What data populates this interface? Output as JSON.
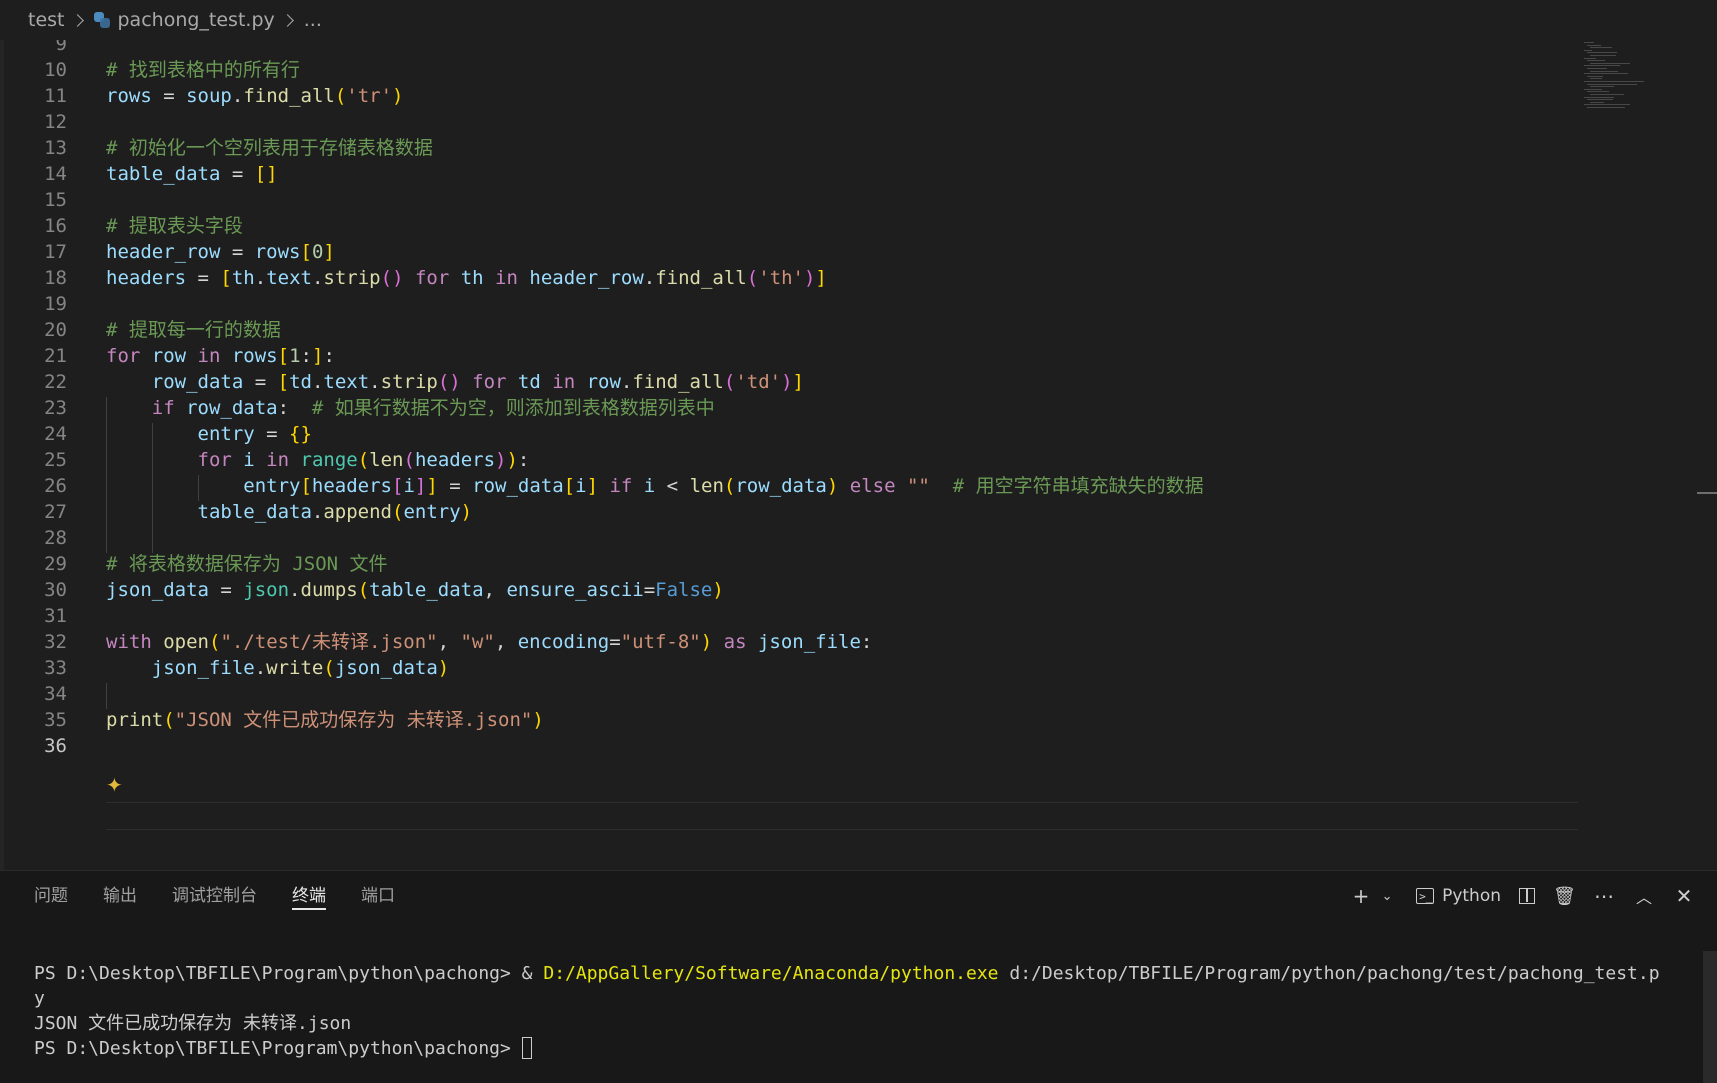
{
  "breadcrumb": {
    "folder": "test",
    "file": "pachong_test.py",
    "more": "..."
  },
  "editor": {
    "active_line": "36",
    "lines": [
      {
        "n": "9",
        "tokens": []
      },
      {
        "n": "10",
        "tokens": [
          {
            "t": "# 找到表格中的所有行",
            "c": "t-com"
          }
        ]
      },
      {
        "n": "11",
        "tokens": [
          {
            "t": "rows",
            "c": "t-var"
          },
          {
            "t": " = ",
            "c": "t-op"
          },
          {
            "t": "soup",
            "c": "t-var"
          },
          {
            "t": ".",
            "c": "t-op"
          },
          {
            "t": "find_all",
            "c": "t-fn"
          },
          {
            "t": "(",
            "c": "b1"
          },
          {
            "t": "'tr'",
            "c": "t-str"
          },
          {
            "t": ")",
            "c": "b1"
          }
        ]
      },
      {
        "n": "12",
        "tokens": []
      },
      {
        "n": "13",
        "tokens": [
          {
            "t": "# 初始化一个空列表用于存储表格数据",
            "c": "t-com"
          }
        ]
      },
      {
        "n": "14",
        "tokens": [
          {
            "t": "table_data",
            "c": "t-var"
          },
          {
            "t": " = ",
            "c": "t-op"
          },
          {
            "t": "[]",
            "c": "b1"
          }
        ]
      },
      {
        "n": "15",
        "tokens": []
      },
      {
        "n": "16",
        "tokens": [
          {
            "t": "# 提取表头字段",
            "c": "t-com"
          }
        ]
      },
      {
        "n": "17",
        "tokens": [
          {
            "t": "header_row",
            "c": "t-var"
          },
          {
            "t": " = ",
            "c": "t-op"
          },
          {
            "t": "rows",
            "c": "t-var"
          },
          {
            "t": "[",
            "c": "b1"
          },
          {
            "t": "0",
            "c": "t-num"
          },
          {
            "t": "]",
            "c": "b1"
          }
        ]
      },
      {
        "n": "18",
        "tokens": [
          {
            "t": "headers",
            "c": "t-var"
          },
          {
            "t": " = ",
            "c": "t-op"
          },
          {
            "t": "[",
            "c": "b1"
          },
          {
            "t": "th",
            "c": "t-var"
          },
          {
            "t": ".",
            "c": "t-op"
          },
          {
            "t": "text",
            "c": "t-var"
          },
          {
            "t": ".",
            "c": "t-op"
          },
          {
            "t": "strip",
            "c": "t-fn"
          },
          {
            "t": "()",
            "c": "b2"
          },
          {
            "t": " for ",
            "c": "t-kw"
          },
          {
            "t": "th",
            "c": "t-var"
          },
          {
            "t": " in ",
            "c": "t-kw"
          },
          {
            "t": "header_row",
            "c": "t-var"
          },
          {
            "t": ".",
            "c": "t-op"
          },
          {
            "t": "find_all",
            "c": "t-fn"
          },
          {
            "t": "(",
            "c": "b2"
          },
          {
            "t": "'th'",
            "c": "t-str"
          },
          {
            "t": ")",
            "c": "b2"
          },
          {
            "t": "]",
            "c": "b1"
          }
        ]
      },
      {
        "n": "19",
        "tokens": []
      },
      {
        "n": "20",
        "tokens": [
          {
            "t": "# 提取每一行的数据",
            "c": "t-com"
          }
        ]
      },
      {
        "n": "21",
        "tokens": [
          {
            "t": "for",
            "c": "t-kw"
          },
          {
            "t": " row",
            "c": "t-var"
          },
          {
            "t": " in ",
            "c": "t-kw"
          },
          {
            "t": "rows",
            "c": "t-var"
          },
          {
            "t": "[",
            "c": "b1"
          },
          {
            "t": "1",
            "c": "t-num"
          },
          {
            "t": ":",
            "c": "t-op"
          },
          {
            "t": "]",
            "c": "b1"
          },
          {
            "t": ":",
            "c": "t-op"
          }
        ]
      },
      {
        "n": "22",
        "tokens": [
          {
            "t": "    row_data",
            "c": "t-var"
          },
          {
            "t": " = ",
            "c": "t-op"
          },
          {
            "t": "[",
            "c": "b1"
          },
          {
            "t": "td",
            "c": "t-var"
          },
          {
            "t": ".",
            "c": "t-op"
          },
          {
            "t": "text",
            "c": "t-var"
          },
          {
            "t": ".",
            "c": "t-op"
          },
          {
            "t": "strip",
            "c": "t-fn"
          },
          {
            "t": "()",
            "c": "b2"
          },
          {
            "t": " for ",
            "c": "t-kw"
          },
          {
            "t": "td",
            "c": "t-var"
          },
          {
            "t": " in ",
            "c": "t-kw"
          },
          {
            "t": "row",
            "c": "t-var"
          },
          {
            "t": ".",
            "c": "t-op"
          },
          {
            "t": "find_all",
            "c": "t-fn"
          },
          {
            "t": "(",
            "c": "b2"
          },
          {
            "t": "'td'",
            "c": "t-str"
          },
          {
            "t": ")",
            "c": "b2"
          },
          {
            "t": "]",
            "c": "b1"
          }
        ]
      },
      {
        "n": "23",
        "tokens": [
          {
            "t": "    if",
            "c": "t-kw"
          },
          {
            "t": " row_data",
            "c": "t-var"
          },
          {
            "t": ":  ",
            "c": "t-op"
          },
          {
            "t": "# 如果行数据不为空，则添加到表格数据列表中",
            "c": "t-com"
          }
        ]
      },
      {
        "n": "24",
        "tokens": [
          {
            "t": "        entry",
            "c": "t-var"
          },
          {
            "t": " = ",
            "c": "t-op"
          },
          {
            "t": "{}",
            "c": "b1"
          }
        ]
      },
      {
        "n": "25",
        "tokens": [
          {
            "t": "        for",
            "c": "t-kw"
          },
          {
            "t": " i",
            "c": "t-var"
          },
          {
            "t": " in ",
            "c": "t-kw"
          },
          {
            "t": "range",
            "c": "t-cls"
          },
          {
            "t": "(",
            "c": "b1"
          },
          {
            "t": "len",
            "c": "t-fn"
          },
          {
            "t": "(",
            "c": "b2"
          },
          {
            "t": "headers",
            "c": "t-var"
          },
          {
            "t": ")",
            "c": "b2"
          },
          {
            "t": ")",
            "c": "b1"
          },
          {
            "t": ":",
            "c": "t-op"
          }
        ]
      },
      {
        "n": "26",
        "tokens": [
          {
            "t": "            entry",
            "c": "t-var"
          },
          {
            "t": "[",
            "c": "b1"
          },
          {
            "t": "headers",
            "c": "t-var"
          },
          {
            "t": "[",
            "c": "b2"
          },
          {
            "t": "i",
            "c": "t-var"
          },
          {
            "t": "]",
            "c": "b2"
          },
          {
            "t": "]",
            "c": "b1"
          },
          {
            "t": " = ",
            "c": "t-op"
          },
          {
            "t": "row_data",
            "c": "t-var"
          },
          {
            "t": "[",
            "c": "b1"
          },
          {
            "t": "i",
            "c": "t-var"
          },
          {
            "t": "]",
            "c": "b1"
          },
          {
            "t": " if",
            "c": "t-kw"
          },
          {
            "t": " i",
            "c": "t-var"
          },
          {
            "t": " < ",
            "c": "t-op"
          },
          {
            "t": "len",
            "c": "t-fn"
          },
          {
            "t": "(",
            "c": "b1"
          },
          {
            "t": "row_data",
            "c": "t-var"
          },
          {
            "t": ")",
            "c": "b1"
          },
          {
            "t": " else ",
            "c": "t-kw"
          },
          {
            "t": "\"\"",
            "c": "t-str"
          },
          {
            "t": "  ",
            "c": "t-op"
          },
          {
            "t": "# 用空字符串填充缺失的数据",
            "c": "t-com"
          }
        ]
      },
      {
        "n": "27",
        "tokens": [
          {
            "t": "        table_data",
            "c": "t-var"
          },
          {
            "t": ".",
            "c": "t-op"
          },
          {
            "t": "append",
            "c": "t-fn"
          },
          {
            "t": "(",
            "c": "b1"
          },
          {
            "t": "entry",
            "c": "t-var"
          },
          {
            "t": ")",
            "c": "b1"
          }
        ]
      },
      {
        "n": "28",
        "tokens": []
      },
      {
        "n": "29",
        "tokens": [
          {
            "t": "# 将表格数据保存为 JSON 文件",
            "c": "t-com"
          }
        ]
      },
      {
        "n": "30",
        "tokens": [
          {
            "t": "json_data",
            "c": "t-var"
          },
          {
            "t": " = ",
            "c": "t-op"
          },
          {
            "t": "json",
            "c": "t-cls"
          },
          {
            "t": ".",
            "c": "t-op"
          },
          {
            "t": "dumps",
            "c": "t-fn"
          },
          {
            "t": "(",
            "c": "b1"
          },
          {
            "t": "table_data",
            "c": "t-var"
          },
          {
            "t": ", ",
            "c": "t-op"
          },
          {
            "t": "ensure_ascii",
            "c": "t-var"
          },
          {
            "t": "=",
            "c": "t-op"
          },
          {
            "t": "False",
            "c": "t-kw2"
          },
          {
            "t": ")",
            "c": "b1"
          }
        ]
      },
      {
        "n": "31",
        "tokens": []
      },
      {
        "n": "32",
        "tokens": [
          {
            "t": "with",
            "c": "t-kw"
          },
          {
            "t": " ",
            "c": "t-op"
          },
          {
            "t": "open",
            "c": "t-fn"
          },
          {
            "t": "(",
            "c": "b1"
          },
          {
            "t": "\"./test/未转译.json\"",
            "c": "t-str"
          },
          {
            "t": ", ",
            "c": "t-op"
          },
          {
            "t": "\"w\"",
            "c": "t-str"
          },
          {
            "t": ", ",
            "c": "t-op"
          },
          {
            "t": "encoding",
            "c": "t-var"
          },
          {
            "t": "=",
            "c": "t-op"
          },
          {
            "t": "\"utf-8\"",
            "c": "t-str"
          },
          {
            "t": ")",
            "c": "b1"
          },
          {
            "t": " as ",
            "c": "t-kw"
          },
          {
            "t": "json_file",
            "c": "t-var"
          },
          {
            "t": ":",
            "c": "t-op"
          }
        ]
      },
      {
        "n": "33",
        "tokens": [
          {
            "t": "    json_file",
            "c": "t-var"
          },
          {
            "t": ".",
            "c": "t-op"
          },
          {
            "t": "write",
            "c": "t-fn"
          },
          {
            "t": "(",
            "c": "b1"
          },
          {
            "t": "json_data",
            "c": "t-var"
          },
          {
            "t": ")",
            "c": "b1"
          }
        ]
      },
      {
        "n": "34",
        "tokens": []
      },
      {
        "n": "35",
        "tokens": [
          {
            "t": "print",
            "c": "t-fn"
          },
          {
            "t": "(",
            "c": "b1"
          },
          {
            "t": "\"JSON 文件已成功保存为 未转译.json\"",
            "c": "t-str"
          },
          {
            "t": ")",
            "c": "b1"
          }
        ]
      },
      {
        "n": "36",
        "tokens": []
      }
    ]
  },
  "panel": {
    "tabs": [
      {
        "label": "问题",
        "active": false
      },
      {
        "label": "输出",
        "active": false
      },
      {
        "label": "调试控制台",
        "active": false
      },
      {
        "label": "终端",
        "active": true
      },
      {
        "label": "端口",
        "active": false
      }
    ],
    "actions": {
      "add_icon": "plus-icon",
      "dropdown_icon": "chevron-down-icon",
      "terminal_profile": "Python",
      "split_icon": "split-editor-icon",
      "trash_icon": "trash-icon",
      "more_icon": "ellipsis-icon",
      "maximize_icon": "chevron-up-icon",
      "close_icon": "close-icon"
    },
    "terminal": {
      "prompt": "PS D:\\Desktop\\TBFILE\\Program\\python\\pachong> ",
      "cmd_amp": "& ",
      "cmd_exe": "D:/AppGallery/Software/Anaconda/python.exe",
      "cmd_arg": " d:/Desktop/TBFILE/Program/python/pachong/test/pachong_test.p",
      "cmd_wrap": "y",
      "output": "JSON 文件已成功保存为 未转译.json",
      "prompt2": "PS D:\\Desktop\\TBFILE\\Program\\python\\pachong> "
    }
  },
  "colors": {
    "background": "#1e1e1e",
    "panel_background": "#181818",
    "comment": "#6a9955",
    "variable": "#9cdcfe",
    "function": "#dcdcaa",
    "string": "#ce9178",
    "keyword": "#c586c0",
    "bracket_1": "#ffd700",
    "bracket_2": "#da70d6"
  }
}
